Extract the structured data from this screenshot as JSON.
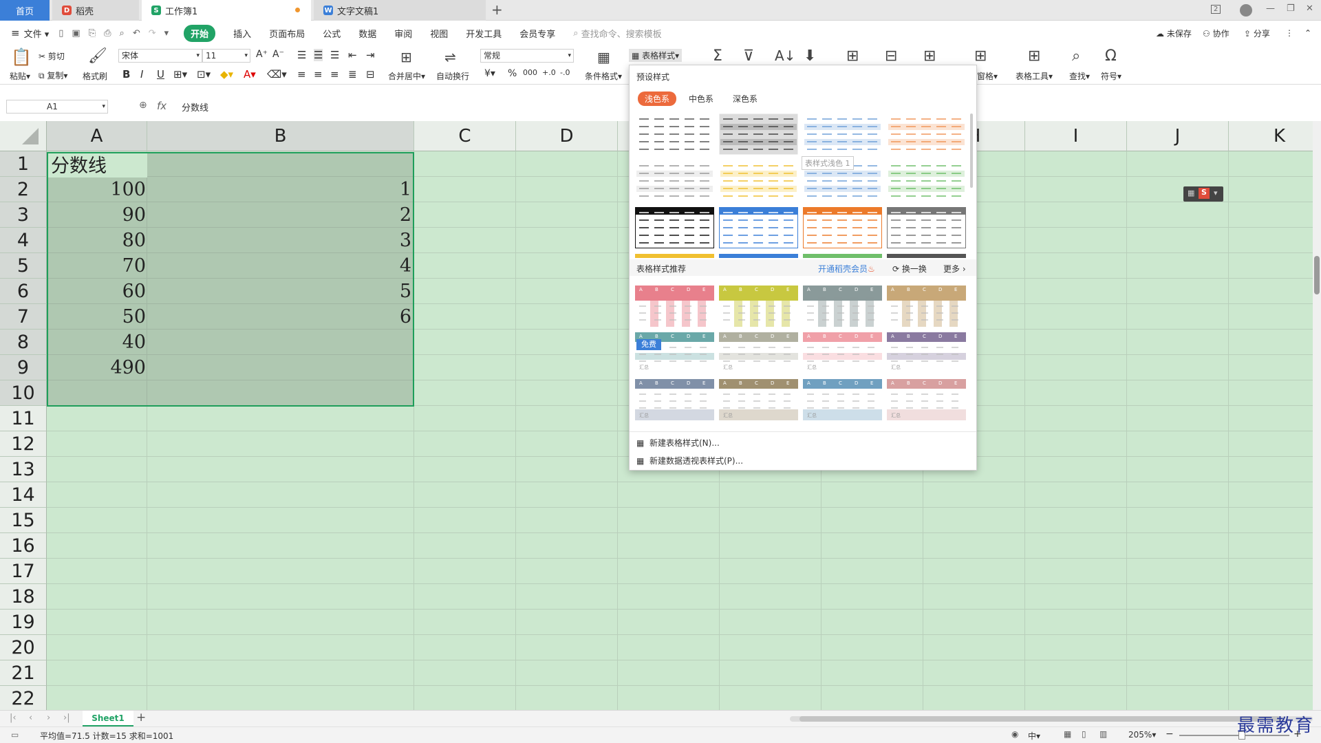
{
  "titlebar": {
    "tabs": [
      {
        "label": "首页"
      },
      {
        "label": "稻壳"
      },
      {
        "label": "工作簿1"
      },
      {
        "label": "文字文稿1"
      }
    ],
    "page_count": "2"
  },
  "menubar": {
    "file": "文件",
    "items": [
      "开始",
      "插入",
      "页面布局",
      "公式",
      "数据",
      "审阅",
      "视图",
      "开发工具",
      "会员专享"
    ],
    "search_placeholder": "查找命令、搜索模板",
    "unsaved": "未保存",
    "collab": "协作",
    "share": "分享"
  },
  "ribbon": {
    "paste": "粘贴",
    "cut": "剪切",
    "copy": "复制",
    "format_painter": "格式刷",
    "font_name": "宋体",
    "font_size": "11",
    "merge": "合并居中",
    "wrap": "自动换行",
    "number_format": "常规",
    "cond_format": "条件格式",
    "table_style": "表格样式",
    "freeze": "窗格",
    "table_tools": "表格工具",
    "find": "查找",
    "symbol": "符号"
  },
  "formula_bar": {
    "cell_ref": "A1",
    "fx": "fx",
    "content": "分数线"
  },
  "grid": {
    "columns": [
      "A",
      "B",
      "C",
      "D",
      "E",
      "F",
      "G",
      "H",
      "I",
      "J",
      "K"
    ],
    "rows": [
      "1",
      "2",
      "3",
      "4",
      "5",
      "6",
      "7",
      "8",
      "9",
      "10",
      "11",
      "12",
      "13",
      "14",
      "15",
      "16",
      "17",
      "18",
      "19",
      "20",
      "21",
      "22"
    ],
    "col_a": [
      "分数线",
      "100",
      "90",
      "80",
      "70",
      "60",
      "50",
      "40",
      "490"
    ],
    "col_b": [
      "1",
      "2",
      "3",
      "4",
      "5",
      "6"
    ]
  },
  "dropdown": {
    "title": "预设样式",
    "tabs": [
      "浅色系",
      "中色系",
      "深色系"
    ],
    "tooltip": "表样式浅色 1",
    "recommend": "表格样式推荐",
    "vip": "开通稻壳会员",
    "refresh": "换一换",
    "more": "更多",
    "free": "免费",
    "new_style": "新建表格样式(N)...",
    "new_pivot_style": "新建数据透视表样式(P)...",
    "rec_header": [
      "A",
      "B",
      "C",
      "D",
      "E"
    ],
    "summary": "汇总"
  },
  "sheetbar": {
    "sheet": "Sheet1"
  },
  "statusbar": {
    "stats": "平均值=71.5  计数=15  求和=1001",
    "zoom": "205%",
    "ime": "中"
  },
  "watermark": "最需教育",
  "colors": {
    "accent": "#21a366",
    "selection_border": "#1e9e5a",
    "home_tab": "#3b7fd8",
    "grid_bg": "#cce8cf"
  }
}
